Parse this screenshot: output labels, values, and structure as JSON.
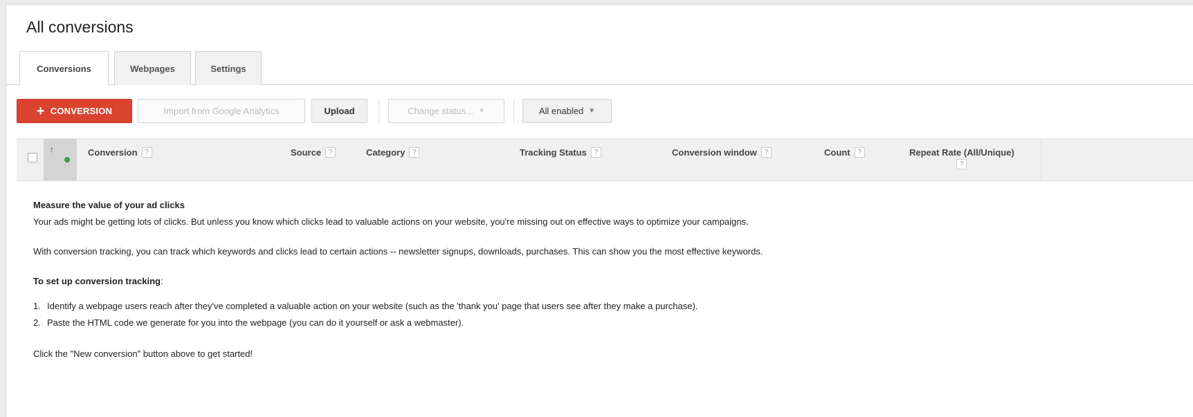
{
  "page": {
    "title": "All conversions"
  },
  "tabs": [
    {
      "label": "Conversions",
      "active": true
    },
    {
      "label": "Webpages",
      "active": false
    },
    {
      "label": "Settings",
      "active": false
    }
  ],
  "toolbar": {
    "new_conversion_plus": "+",
    "new_conversion_label": "CONVERSION",
    "import_label": "Import from Google Analytics",
    "upload_label": "Upload",
    "change_status_label": "Change status...",
    "filter_label": "All enabled",
    "caret": "▼"
  },
  "table": {
    "sort_arrow": "↑",
    "help_icon": "?",
    "columns": [
      "Conversion",
      "Source",
      "Category",
      "Tracking Status",
      "Conversion window",
      "Count",
      "Repeat Rate (All/Unique)"
    ]
  },
  "empty_state": {
    "heading": "Measure the value of your ad clicks",
    "para1": "Your ads might be getting lots of clicks. But unless you know which clicks lead to valuable actions on your website, you're missing out on effective ways to optimize your campaigns.",
    "para2": "With conversion tracking, you can track which keywords and clicks lead to certain actions -- newsletter signups, downloads, purchases. This can show you the most effective keywords.",
    "setup_heading": "To set up conversion tracking",
    "setup_colon": ":",
    "steps": [
      {
        "num": "1.",
        "text": "Identify a webpage users reach after they've completed a valuable action on your website (such as the 'thank you' page that users see after they make a purchase)."
      },
      {
        "num": "2.",
        "text": "Paste the HTML code we generate for you into the webpage (you can do it yourself or ask a webmaster)."
      }
    ],
    "cta": "Click the \"New conversion\" button above to get started!"
  },
  "colors": {
    "primary_button": "#d9432f",
    "status_enabled": "#37a24b"
  }
}
